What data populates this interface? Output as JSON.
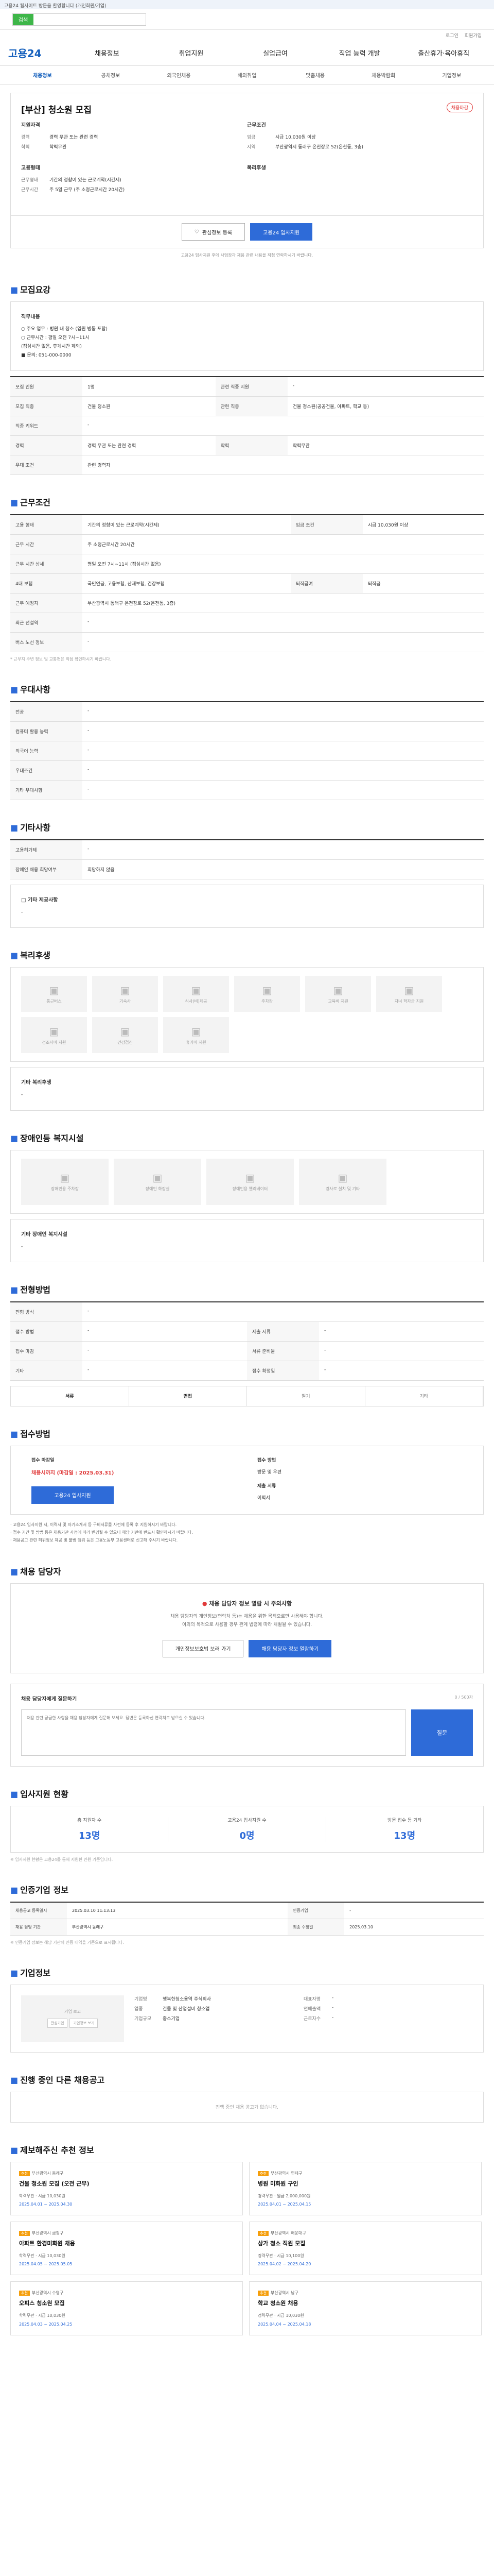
{
  "top_note": "고용24 웹사이트 방문을 환영합니다 (개인회원/기업)",
  "search": {
    "btn": "검색"
  },
  "util": [
    "로그인",
    "회원가입"
  ],
  "logo": "고용24",
  "gnb": [
    "채용정보",
    "취업지원",
    "실업급여",
    "직업 능력 개발",
    "출산휴가·육아휴직"
  ],
  "lnb": [
    "채용정보",
    "공채정보",
    "외국인채용",
    "해외취업",
    "맞춤채용",
    "채용박람회",
    "기업정보"
  ],
  "title": "[부산] 청소원 모집",
  "badge": "채용마감",
  "summary": {
    "job": {
      "title": "지원자격",
      "rows": [
        [
          "경력",
          "경력 무관 또는 관련 경력"
        ],
        [
          "학력",
          "학력무관"
        ]
      ]
    },
    "cond": {
      "title": "근무조건",
      "rows": [
        [
          "임금",
          "시급 10,030원 이상"
        ],
        [
          "지역",
          "부산광역시 동래구 온천장로 52(온천동, 3층)"
        ]
      ]
    },
    "type": {
      "title": "고용형태",
      "rows": [
        [
          "근무형태",
          "기간의 정함이 있는 근로계약(시간제)"
        ],
        [
          "근무시간",
          "주 5일 근무 (주 소정근로시간 20시간)"
        ]
      ]
    },
    "welfare": {
      "title": "복리후생",
      "rows": []
    }
  },
  "actions": {
    "interest": "관심정보 등록",
    "apply": "고용24 입사지원"
  },
  "notice_line": "고용24 입사지원 후에 사업장과 채용 관련 내용을 직접 연락하시기 바랍니다.",
  "sections": {
    "job_desc": "모집요강",
    "work_cond": "근무조건",
    "welfare": "우대사항",
    "others": "기타사항",
    "benefits": "복리후생",
    "disability": "장애인등 복지시설",
    "method": "전형방법",
    "apply_method": "접수방법",
    "manager": "채용 담당자",
    "applicants": "입사지원 현황",
    "company_info": "인증기업 정보",
    "company": "기업정보",
    "other_jobs": "진행 중인 다른 채용공고",
    "recommend": "제보해주신 추천 정보"
  },
  "job_text": {
    "title": "직무내용",
    "lines": [
      "○ 주요 업무 : 병원 내 청소 (입원 병동 포함)",
      "○ 근무시간 : 평일 오전 7시~11시",
      "  (점심시간 없음, 휴게시간 제외)",
      "■ 문의: 051-000-0000"
    ]
  },
  "job_table": [
    [
      "모집 인원",
      "1명",
      "관련 직종 지원",
      "-"
    ],
    [
      "모집 직종",
      "건물 청소원",
      "관련 직종",
      "건물 청소원(공공건물, 아파트, 학교 등)"
    ],
    [
      "직종 키워드",
      "-",
      "",
      ""
    ],
    [
      "경력",
      "경력 무관 또는 관련 경력",
      "학력",
      "학력무관"
    ],
    [
      "우대 조건",
      "관련 경력자",
      "",
      ""
    ]
  ],
  "cond_table": [
    [
      "고용 형태",
      "기간의 정함이 있는 근로계약(시간제)",
      "임금 조건",
      "시급 10,030원 이상"
    ],
    [
      "근무 시간",
      "주 소정근로시간 20시간",
      "",
      ""
    ],
    [
      "근무 시간 상세",
      "평일 오전 7시~11시 (점심시간 없음)",
      "",
      ""
    ],
    [
      "4대 보험",
      "국민연금, 고용보험, 산재보험, 건강보험",
      "퇴직급여",
      "퇴직금"
    ],
    [
      "근무 예정지",
      "부산광역시 동래구 온천장로 52(온천동, 3층)",
      "",
      ""
    ],
    [
      "최근 전철역",
      "-",
      "",
      ""
    ],
    [
      "버스 노선 정보",
      "-",
      "",
      ""
    ]
  ],
  "cond_note": "* 근무지 주변 정보 및 교통편은 직접 확인하시기 바랍니다.",
  "welfare_table": [
    [
      "전공",
      "-"
    ],
    [
      "컴퓨터 활용 능력",
      "-"
    ],
    [
      "외국어 능력",
      "-"
    ],
    [
      "우대조건",
      "-"
    ],
    [
      "기타 우대사항",
      "-"
    ]
  ],
  "others_table": [
    [
      "고용허가제",
      "-"
    ],
    [
      "장애인 채용 희망여부",
      "희망하지 않음"
    ]
  ],
  "others_note": "□ 기타 제공사항",
  "others_val": "-",
  "benefit_icons": [
    "통근버스",
    "기숙사",
    "식사(비)제공",
    "주차장",
    "교육비 지원",
    "자녀 학자금 지원",
    "경조사비 지원",
    "건강검진",
    "휴가비 지원"
  ],
  "benefit_note": "기타 복리후생",
  "benefit_val": "-",
  "disability_icons": [
    "장애인용 주차장",
    "장애인 화장실",
    "장애인용 엘리베이터",
    "경사로 설치 및 기타"
  ],
  "disability_note": "기타 장애인 복지시설",
  "disability_val": "-",
  "method_table": [
    [
      "전형 방식",
      "-",
      "",
      ""
    ],
    [
      "접수 방법",
      "-",
      "제출 서류",
      "-"
    ],
    [
      "접수 마감",
      "-",
      "서류 준비물",
      "-"
    ],
    [
      "기타",
      "-",
      "접수 확정일",
      "-"
    ]
  ],
  "method_tabs": [
    "서류",
    "면접",
    "필기",
    "기타"
  ],
  "apply_box": {
    "l1": "접수 마감일",
    "v1": "채용시까지 (마감일 : 2025.03.31)",
    "l2": "접수 방법",
    "v2": "방문 및 우편",
    "l3": "제출 서류",
    "v3": "이력서",
    "btn": "고용24 입사지원"
  },
  "apply_bullets": [
    "· 고용24 입사지원 시, 이력서 및 자기소개서 등 구비서류를 사전에 등록 후 지원하시기 바랍니다.",
    "· 접수 기간 및 방법 등은 채용기관 사정에 따라 변경될 수 있으니 해당 기관에 반드시 확인하시기 바랍니다.",
    "· 채용공고 관련 허위정보 제공 및 불법 행위 등은 고용노동부 고용센터로 신고해 주시기 바랍니다."
  ],
  "manager": {
    "warn": "채용 담당자 정보 열람 시 주의사항",
    "p1": "채용 담당자의 개인정보(연락처 등)는 채용을 위한 목적으로만 사용해야 합니다.",
    "p2": "이외의 목적으로 사용할 경우 관계 법령에 따라 처벌될 수 있습니다.",
    "b1": "개인정보보호법 보러 가기",
    "b2": "채용 담당자 정보 열람하기"
  },
  "inquiry": {
    "title": "채용 담당자에게 질문하기",
    "sub": "0 / 500자",
    "placeholder": "채용 관련 궁금한 사항을 채용 담당자에게 질문해 보세요. 답변은 등록하신 연락처로 받으실 수 있습니다.",
    "send": "질문"
  },
  "applicant_stats": [
    [
      "총 지원자 수",
      "13명"
    ],
    [
      "고용24 입사지원 수",
      "0명"
    ],
    [
      "방문 접수 등 기타",
      "13명"
    ]
  ],
  "applicant_note": "※ 입사지원 현황은 고용24를 통해 지원한 인원 기준입니다.",
  "company_table": [
    [
      "채용공고 등록일시",
      "2025.03.10 11:13:13",
      "인증기업",
      "-"
    ],
    [
      "채용 담당 기관",
      "부산광역시 동래구",
      "최종 수정일",
      "2025.03.10"
    ]
  ],
  "company_note": "※ 인증기업 정보는 해당 기관의 인증 내역을 기준으로 표시됩니다.",
  "company_box": {
    "logo": "기업 로고",
    "b1": "관심기업",
    "b2": "기업정보 보기",
    "rows": [
      [
        "기업명",
        "행복한청소용역 주식회사"
      ],
      [
        "업종",
        "건물 및 산업설비 청소업"
      ],
      [
        "기업규모",
        "중소기업"
      ]
    ],
    "rows2": [
      [
        "대표자명",
        "-"
      ],
      [
        "연매출액",
        "-"
      ],
      [
        "근로자수",
        "-"
      ]
    ]
  },
  "other_jobs_empty": "진행 중인 채용 공고가 없습니다.",
  "cards": [
    {
      "tag": "추천",
      "org": "부산광역시 동래구",
      "title": "건물 청소원 모집 (오전 근무)",
      "meta": "학력무관 · 시급 10,030원",
      "date": "2025.04.01 ~ 2025.04.30"
    },
    {
      "tag": "추천",
      "org": "부산광역시 연제구",
      "title": "병원 미화원 구인",
      "meta": "경력무관 · 월급 2,000,000원",
      "date": "2025.04.01 ~ 2025.04.15"
    },
    {
      "tag": "추천",
      "org": "부산광역시 금정구",
      "title": "아파트 환경미화원 채용",
      "meta": "학력무관 · 시급 10,030원",
      "date": "2025.04.05 ~ 2025.05.05"
    },
    {
      "tag": "추천",
      "org": "부산광역시 해운대구",
      "title": "상가 청소 직원 모집",
      "meta": "경력무관 · 시급 10,100원",
      "date": "2025.04.02 ~ 2025.04.20"
    },
    {
      "tag": "추천",
      "org": "부산광역시 수영구",
      "title": "오피스 청소원 모집",
      "meta": "학력무관 · 시급 10,030원",
      "date": "2025.04.03 ~ 2025.04.25"
    },
    {
      "tag": "추천",
      "org": "부산광역시 남구",
      "title": "학교 청소원 채용",
      "meta": "경력무관 · 시급 10,030원",
      "date": "2025.04.04 ~ 2025.04.18"
    }
  ]
}
